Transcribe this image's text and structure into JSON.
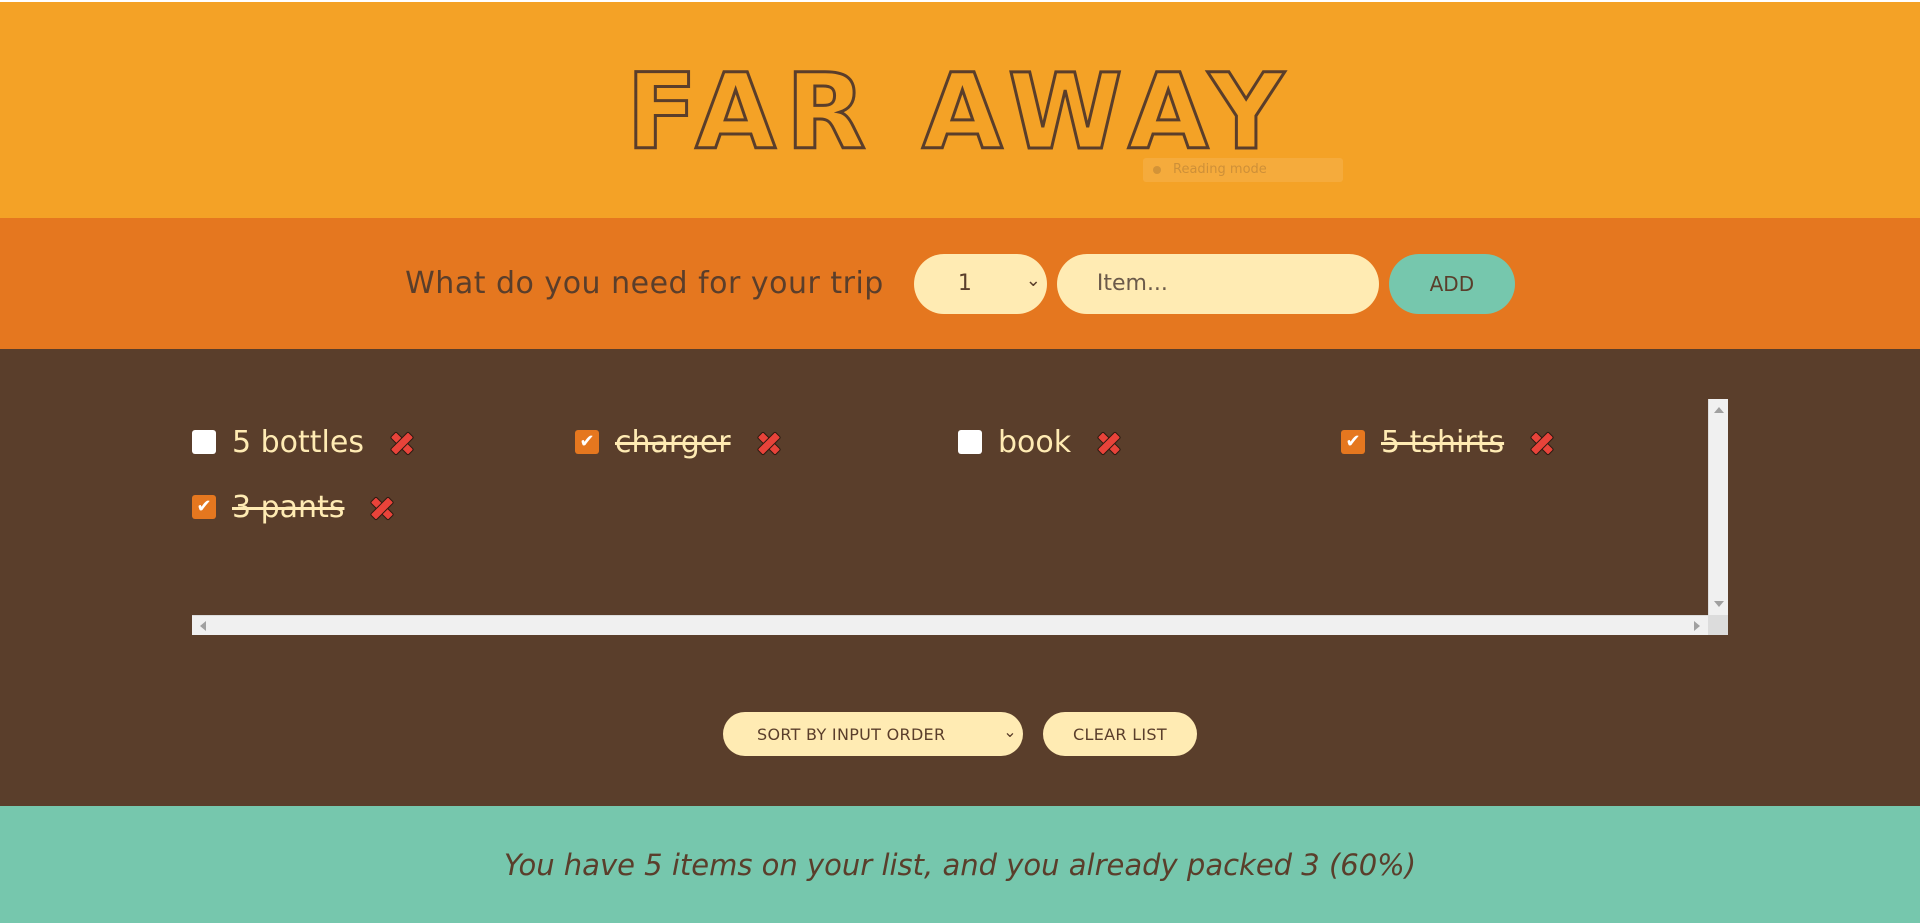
{
  "header": {
    "logo_text": "FAR AWAY",
    "badge_text": "Reading mode"
  },
  "add_form": {
    "prompt": "What do you need for your trip",
    "quantity_value": "1",
    "item_placeholder": "Item...",
    "add_label": "ADD"
  },
  "list": {
    "items": [
      {
        "label": "5 bottles",
        "packed": false
      },
      {
        "label": "charger",
        "packed": true
      },
      {
        "label": "book",
        "packed": false
      },
      {
        "label": "5 tshirts",
        "packed": true
      },
      {
        "label": "3 pants",
        "packed": true
      }
    ]
  },
  "actions": {
    "sort_value": "SORT BY INPUT ORDER",
    "clear_label": "CLEAR LIST"
  },
  "stats": {
    "message": "You have 5 items on your list, and you already packed 3 (60%)"
  },
  "colors": {
    "header": "#f4a226",
    "form": "#e5771f",
    "list": "#5a3e2b",
    "footer": "#76c7ad",
    "cream": "#ffebb3",
    "delete": "#e8433a"
  }
}
